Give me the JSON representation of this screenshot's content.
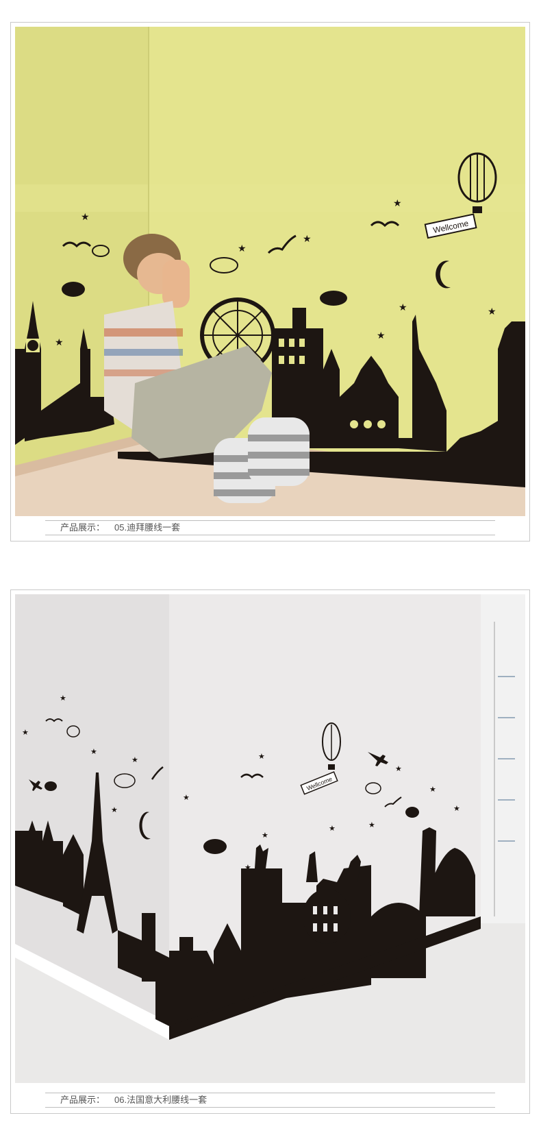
{
  "products": [
    {
      "caption_label": "产品展示：",
      "caption_value": "05.迪拜腰线一套",
      "banner_text": "Wellcome"
    },
    {
      "caption_label": "产品展示：",
      "caption_value": "06.法国意大利腰线一套",
      "banner_text": "Wellcome"
    }
  ],
  "colors": {
    "wall_yellow": "#e2e38a",
    "wall_white": "#e9e8e8",
    "decal_black": "#1d1612",
    "floor_wood": "#e7d2bc",
    "border": "#c8c8c8",
    "caption_text": "#555555"
  },
  "icons": [
    "hot-air-balloon-icon",
    "bird-icon",
    "cloud-icon",
    "star-icon",
    "moon-icon",
    "plane-icon"
  ]
}
